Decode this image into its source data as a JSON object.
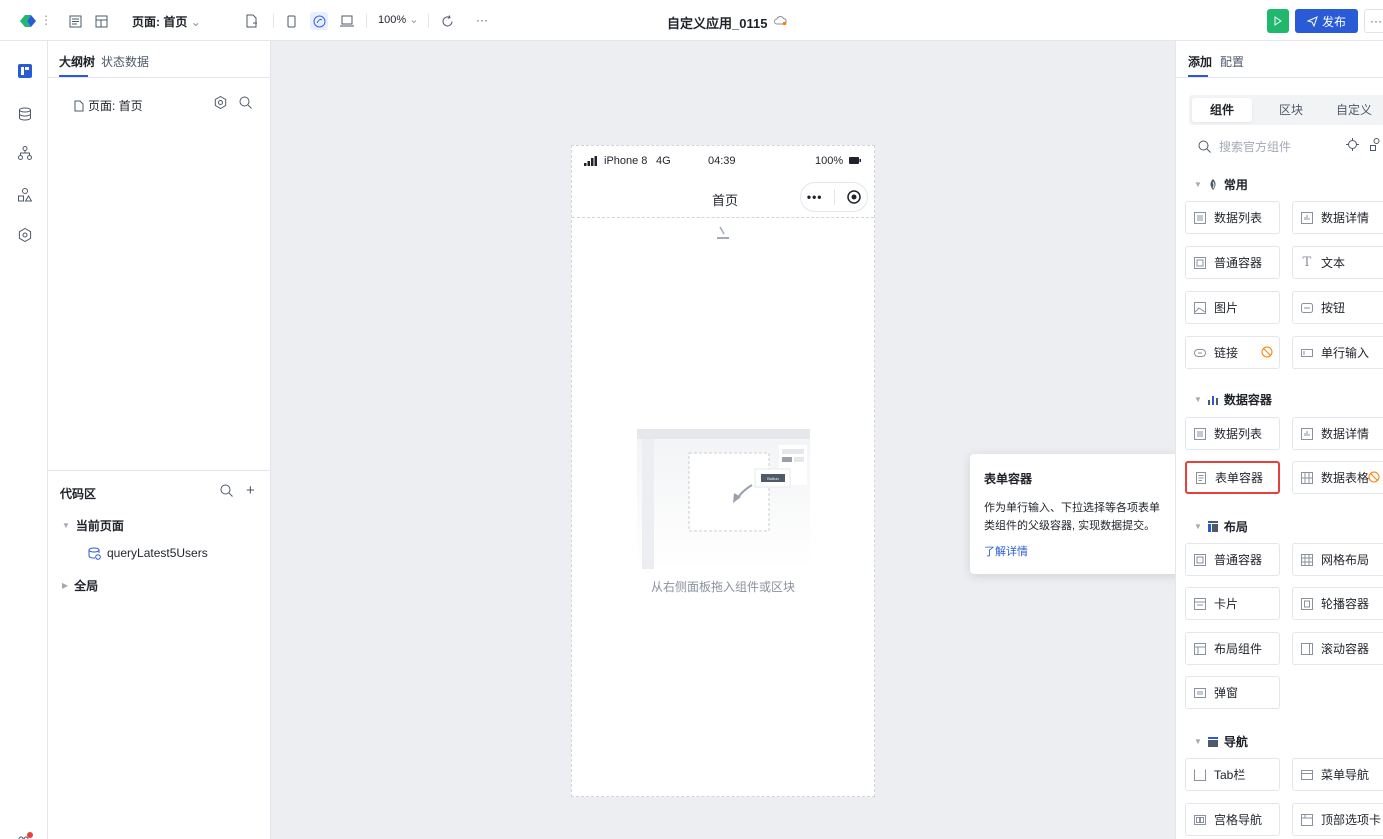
{
  "topbar": {
    "page_selector": "页面: 首页",
    "zoom": "100%",
    "app_title": "自定义应用_0115",
    "publish_label": "发布",
    "more_label": "···"
  },
  "outline": {
    "tab_outline": "大纲树",
    "tab_state": "状态数据",
    "page_node": "页面: 首页",
    "code_area_title": "代码区",
    "current_page": "当前页面",
    "query_item": "queryLatest5Users",
    "global": "全局"
  },
  "phone": {
    "carrier": "iPhone 8",
    "network": "4G",
    "time": "04:39",
    "battery": "100%",
    "nav_title": "首页",
    "button_label": "Button",
    "empty_hint": "从右侧面板拖入组件或区块"
  },
  "tooltip": {
    "title": "表单容器",
    "description": "作为单行输入、下拉选择等各项表单类组件的父级容器, 实现数据提交。",
    "link": "了解详情"
  },
  "right_panel": {
    "tab_add": "添加",
    "tab_config": "配置",
    "seg_component": "组件",
    "seg_block": "区块",
    "seg_custom": "自定义",
    "search_placeholder": "搜索官方组件",
    "sections": {
      "common": "常用",
      "data_container": "数据容器",
      "layout": "布局",
      "nav": "导航"
    },
    "common": [
      "数据列表",
      "数据详情",
      "普通容器",
      "文本",
      "图片",
      "按钮",
      "链接",
      "单行输入"
    ],
    "data_container": [
      "数据列表",
      "数据详情",
      "表单容器",
      "数据表格"
    ],
    "layout": [
      "普通容器",
      "网格布局",
      "卡片",
      "轮播容器",
      "布局组件",
      "滚动容器",
      "弹窗"
    ],
    "nav": [
      "Tab栏",
      "菜单导航",
      "宫格导航",
      "顶部选项卡"
    ]
  },
  "colors": {
    "accent": "#2a5bd7",
    "run": "#1fb86c",
    "highlight": "#e5403a",
    "warning": "#ff7d00"
  }
}
